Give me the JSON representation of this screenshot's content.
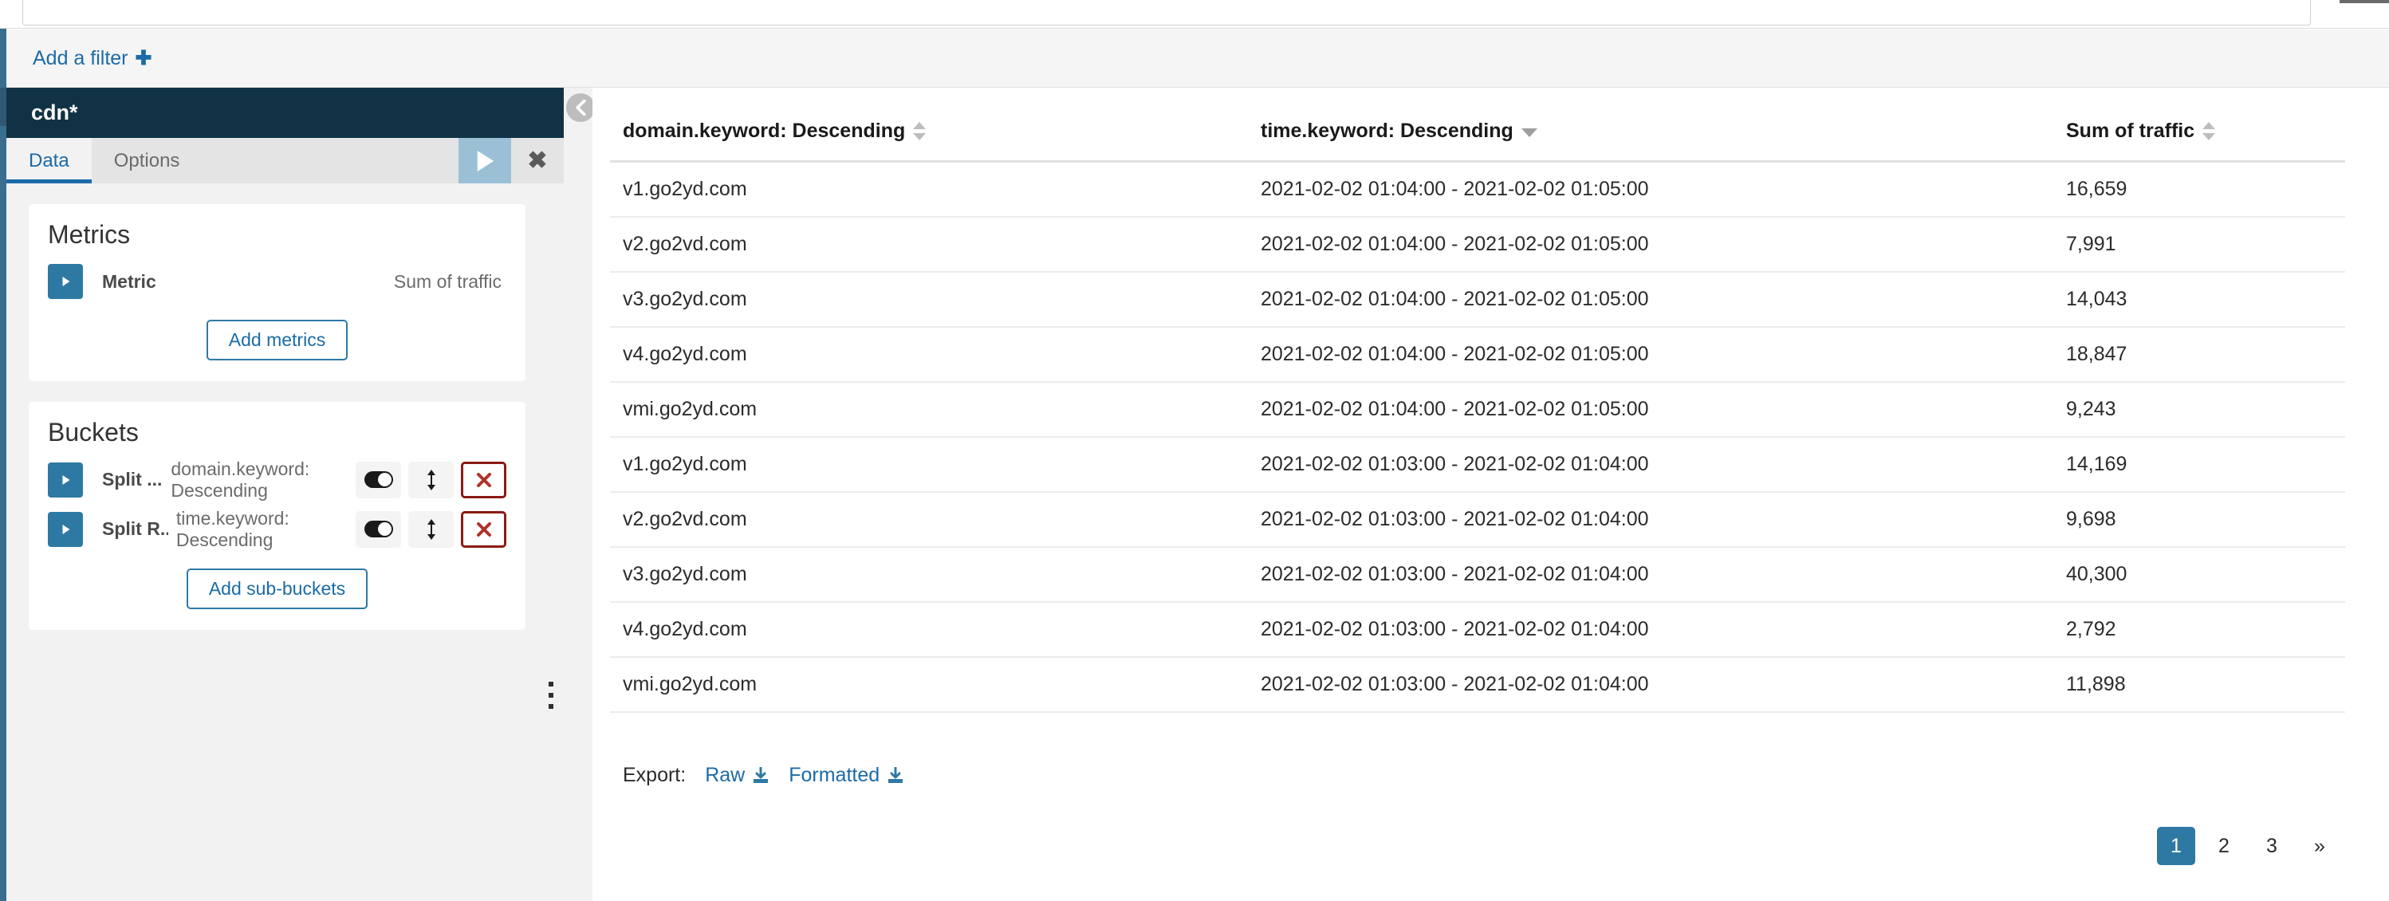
{
  "topbar": {
    "query_value": "",
    "submit_label": ""
  },
  "filter_bar": {
    "add_filter_label": "Add a filter",
    "plus_glyph": "✚"
  },
  "sidebar": {
    "index_pattern_title": "cdn*",
    "tabs": [
      {
        "label": "Data",
        "active": true
      },
      {
        "label": "Options",
        "active": false
      }
    ],
    "apply_label": "",
    "close_glyph": "✖",
    "metrics": {
      "title": "Metrics",
      "rows": [
        {
          "label": "Metric",
          "value": "Sum of traffic"
        }
      ],
      "add_button_label": "Add metrics"
    },
    "buckets": {
      "title": "Buckets",
      "rows": [
        {
          "label": "Split ...",
          "value": "domain.keyword: Descending",
          "controls": [
            "toggle-switch",
            "move-updown",
            "remove"
          ]
        },
        {
          "label": "Split R...",
          "value": "time.keyword: Descending",
          "controls": [
            "toggle-switch",
            "move-updown",
            "remove"
          ]
        }
      ],
      "add_button_label": "Add sub-buckets"
    }
  },
  "table": {
    "columns": [
      {
        "label": "domain.keyword: Descending",
        "sort": "none"
      },
      {
        "label": "time.keyword: Descending",
        "sort": "desc"
      },
      {
        "label": "Sum of traffic",
        "sort": "none"
      }
    ],
    "rows": [
      {
        "domain": "v1.go2yd.com",
        "time": "2021-02-02 01:04:00 - 2021-02-02 01:05:00",
        "traffic": "16,659"
      },
      {
        "domain": "v2.go2vd.com",
        "time": "2021-02-02 01:04:00 - 2021-02-02 01:05:00",
        "traffic": "7,991"
      },
      {
        "domain": "v3.go2yd.com",
        "time": "2021-02-02 01:04:00 - 2021-02-02 01:05:00",
        "traffic": "14,043"
      },
      {
        "domain": "v4.go2yd.com",
        "time": "2021-02-02 01:04:00 - 2021-02-02 01:05:00",
        "traffic": "18,847"
      },
      {
        "domain": "vmi.go2yd.com",
        "time": "2021-02-02 01:04:00 - 2021-02-02 01:05:00",
        "traffic": "9,243"
      },
      {
        "domain": "v1.go2yd.com",
        "time": "2021-02-02 01:03:00 - 2021-02-02 01:04:00",
        "traffic": "14,169"
      },
      {
        "domain": "v2.go2vd.com",
        "time": "2021-02-02 01:03:00 - 2021-02-02 01:04:00",
        "traffic": "9,698"
      },
      {
        "domain": "v3.go2yd.com",
        "time": "2021-02-02 01:03:00 - 2021-02-02 01:04:00",
        "traffic": "40,300"
      },
      {
        "domain": "v4.go2yd.com",
        "time": "2021-02-02 01:03:00 - 2021-02-02 01:04:00",
        "traffic": "2,792"
      },
      {
        "domain": "vmi.go2yd.com",
        "time": "2021-02-02 01:03:00 - 2021-02-02 01:04:00",
        "traffic": "11,898"
      }
    ]
  },
  "export": {
    "label": "Export:",
    "raw_label": "Raw",
    "formatted_label": "Formatted"
  },
  "pagination": {
    "pages": [
      "1",
      "2",
      "3"
    ],
    "next_glyph": "»",
    "current": "1"
  },
  "colors": {
    "accent": "#2e79a4",
    "link": "#1b6ba8",
    "header_dark": "#113245",
    "danger": "#8b1a14",
    "panel_bg": "#f2f2f2"
  }
}
